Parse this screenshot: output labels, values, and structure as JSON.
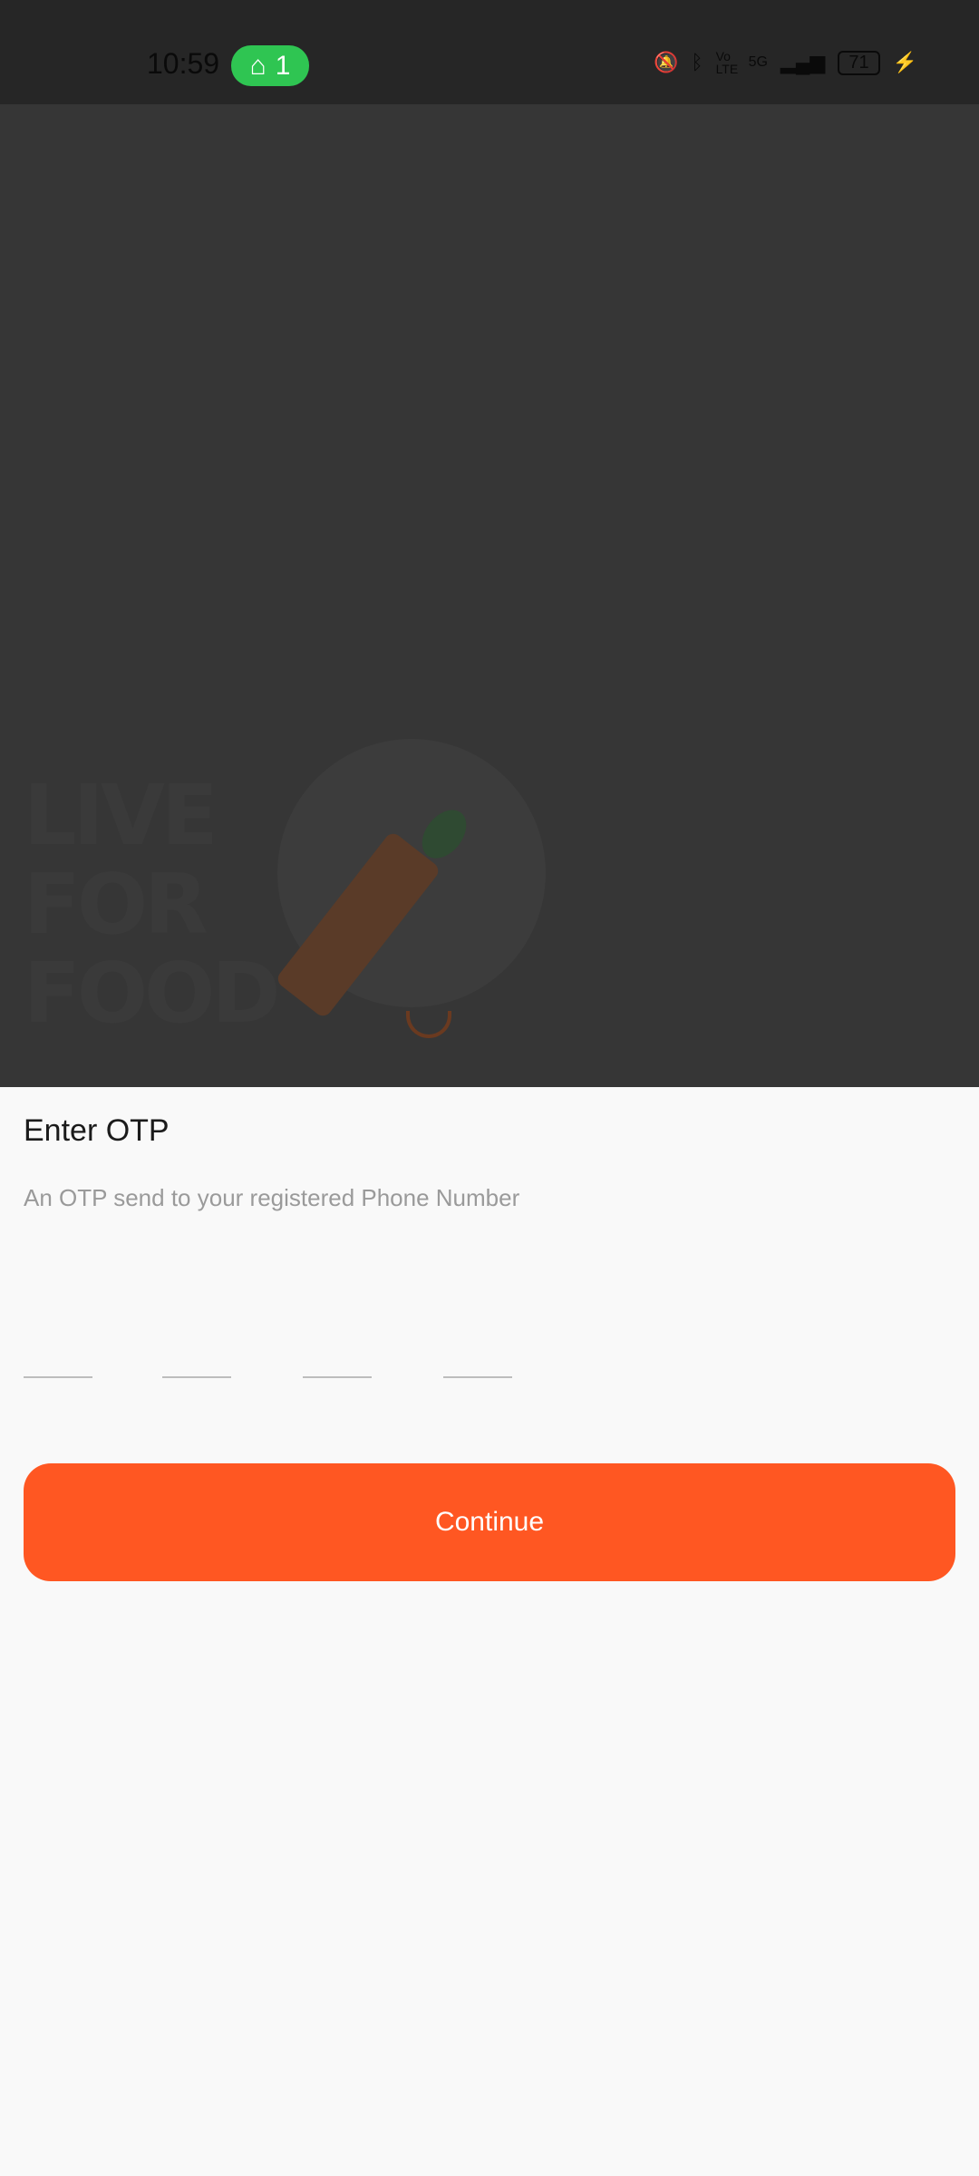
{
  "status_bar": {
    "time": "10:59",
    "hotspot_count": "1",
    "network": "5G",
    "volte": "Vo LTE",
    "battery": "71"
  },
  "hero": {
    "logo_text": "LIVE FOR FOOD"
  },
  "otp": {
    "title": "Enter OTP",
    "subtitle": "An OTP send to your registered Phone Number",
    "digits": [
      "",
      "",
      "",
      ""
    ]
  },
  "actions": {
    "continue_label": "Continue"
  },
  "colors": {
    "accent": "#ff5722",
    "hotspot": "#2fc552"
  }
}
